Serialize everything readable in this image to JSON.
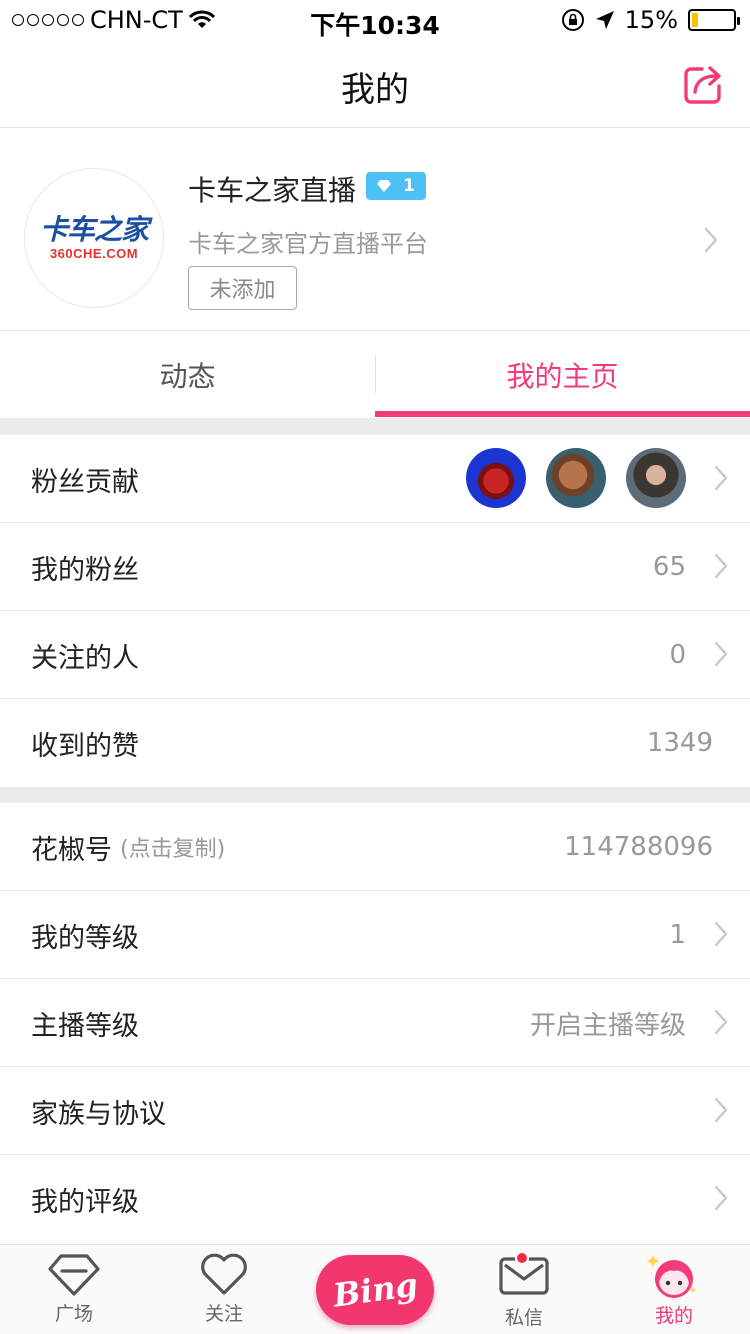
{
  "status_bar": {
    "carrier": "CHN-CT",
    "time": "下午10:34",
    "battery_percent": "15%",
    "battery_level": 0.15
  },
  "nav": {
    "title": "我的"
  },
  "profile": {
    "name": "卡车之家直播",
    "level": "1",
    "description": "卡车之家官方直播平台",
    "add_button": "未添加",
    "logo_text_main": "卡车之家",
    "logo_text_sub": "360CHE.COM"
  },
  "tabs": [
    {
      "label": "动态",
      "active": false
    },
    {
      "label": "我的主页",
      "active": true
    }
  ],
  "section1": {
    "fan_contribution": {
      "label": "粉丝贡献"
    },
    "my_fans": {
      "label": "我的粉丝",
      "value": "65"
    },
    "following": {
      "label": "关注的人",
      "value": "0"
    },
    "likes_received": {
      "label": "收到的赞",
      "value": "1349"
    }
  },
  "section2": {
    "huajiao_id": {
      "label": "花椒号",
      "hint": "(点击复制)",
      "value": "114788096"
    },
    "my_level": {
      "label": "我的等级",
      "value": "1"
    },
    "anchor_level": {
      "label": "主播等级",
      "value": "开启主播等级"
    },
    "family": {
      "label": "家族与协议"
    },
    "my_rating": {
      "label": "我的评级"
    }
  },
  "tab_bar": {
    "items": [
      {
        "label": "广场",
        "icon": "diamond-icon"
      },
      {
        "label": "关注",
        "icon": "heart-icon"
      },
      {
        "label": "Bing",
        "icon": "bing-live-button"
      },
      {
        "label": "私信",
        "icon": "mail-icon"
      },
      {
        "label": "我的",
        "icon": "profile-face-icon"
      }
    ]
  },
  "colors": {
    "accent": "#f33b7c",
    "badge_blue": "#4dc0f5",
    "secondary_text": "#999999"
  }
}
